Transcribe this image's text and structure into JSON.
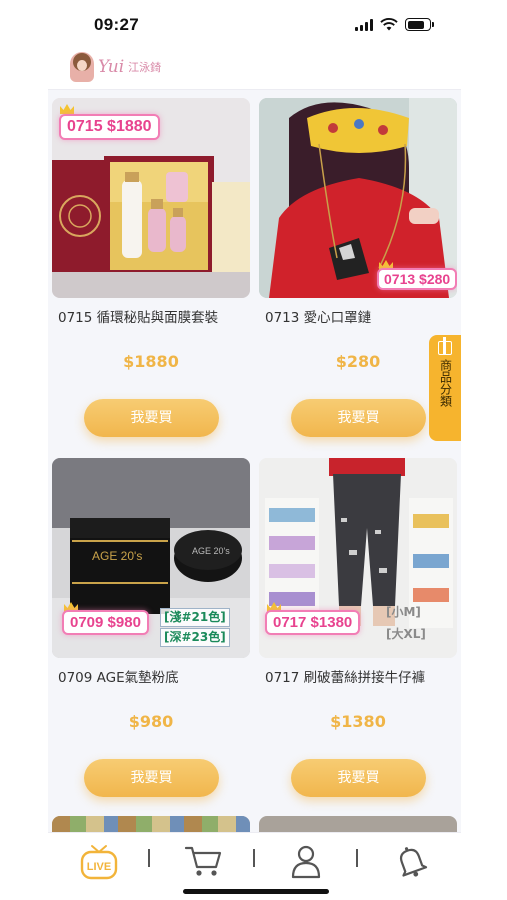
{
  "status_bar": {
    "time": "09:27"
  },
  "header": {
    "brand_script": "Yui",
    "brand_name": "江泳錡"
  },
  "products": [
    {
      "tag": "0715 $1880",
      "title": "0715 循環秘貼與面膜套裝",
      "price": "$1880",
      "buy_label": "我要買"
    },
    {
      "tag": "0713 $280",
      "title": "0713 愛心口罩鏈",
      "price": "$280",
      "buy_label": "我要買"
    },
    {
      "tag": "0709 $980",
      "shades": [
        "[淺#21色]",
        "[深#23色]"
      ],
      "title": "0709 AGE氣墊粉底",
      "price": "$980",
      "buy_label": "我要買"
    },
    {
      "tag": "0717 $1380",
      "sizes": [
        "[小M]",
        "[大XL]"
      ],
      "title": "0717 刷破蕾絲拼接牛仔褲",
      "price": "$1380",
      "buy_label": "我要買"
    }
  ],
  "side_tab": {
    "label": "商品分類"
  },
  "tab_bar": {
    "live_label": "LIVE"
  },
  "colors": {
    "accent": "#f1b64d",
    "price": "#f0b547",
    "tag_pink": "#e8438f",
    "side_tab": "#f6b42e"
  }
}
